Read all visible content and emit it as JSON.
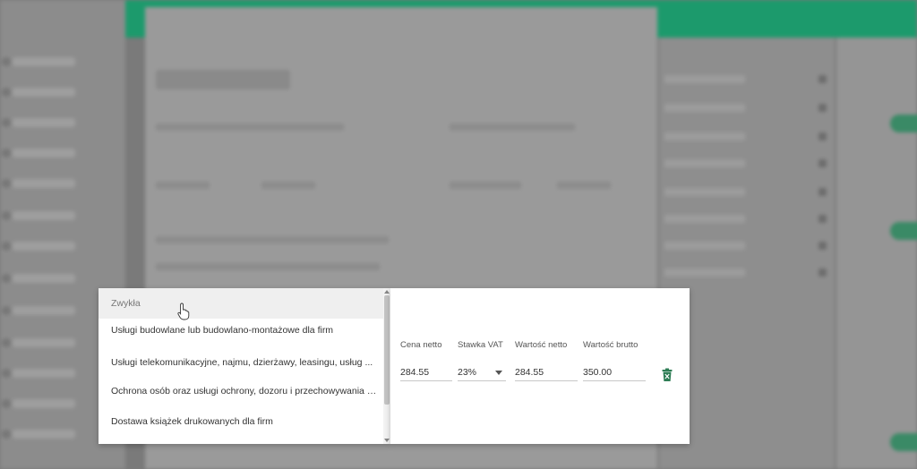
{
  "dropdown": {
    "options": [
      {
        "label": "Zwykła"
      },
      {
        "label": "Usługi budowlane lub budowlano-montażowe dla firm"
      },
      {
        "label": "Usługi telekomunikacyjne, najmu, dzierżawy, leasingu, usług ..."
      },
      {
        "label": "Ochrona osób oraz usługi ochrony, dozoru i przechowywania mi..."
      },
      {
        "label": "Dostawa książek drukowanych dla firm"
      }
    ]
  },
  "line_item": {
    "headers": {
      "net_price": "Cena netto",
      "vat_rate": "Stawka VAT",
      "net_value": "Wartość netto",
      "gross_value": "Wartość brutto"
    },
    "values": {
      "net_price": "284.55",
      "vat_rate": "23%",
      "net_value": "284.55",
      "gross_value": "350.00"
    }
  },
  "colors": {
    "accent": "#1c9a6c",
    "delete_icon": "#2e7d55"
  },
  "icons": [
    "hand-cursor-icon",
    "chevron-down-icon",
    "trash-icon",
    "scroll-up-arrow-icon",
    "scroll-down-arrow-icon"
  ]
}
